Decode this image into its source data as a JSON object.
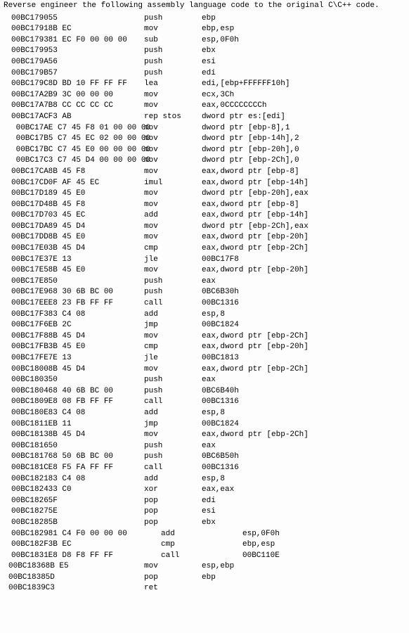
{
  "title": "Reverse engineer the following assembly language code to the original C\\C++ code.",
  "lines": [
    {
      "addr": "00BC1790",
      "bytes": "55",
      "mnem": "push",
      "ops": "ebp",
      "g": 1
    },
    {
      "addr": "00BC1791",
      "bytes": "8B EC",
      "mnem": "mov",
      "ops": "ebp,esp",
      "g": 1
    },
    {
      "addr": "00BC1793",
      "bytes": "81 EC F0 00 00 00",
      "mnem": "sub",
      "ops": "esp,0F0h",
      "g": 1
    },
    {
      "addr": "00BC1799",
      "bytes": "53",
      "mnem": "push",
      "ops": "ebx",
      "g": 1
    },
    {
      "addr": "00BC179A",
      "bytes": "56",
      "mnem": "push",
      "ops": "esi",
      "g": 1
    },
    {
      "addr": "00BC179B",
      "bytes": "57",
      "mnem": "push",
      "ops": "edi",
      "g": 1
    },
    {
      "addr": "00BC179C",
      "bytes": "8D BD 10 FF FF FF",
      "mnem": "lea",
      "ops": "edi,[ebp+FFFFFF10h]",
      "g": 1
    },
    {
      "addr": "00BC17A2",
      "bytes": "B9 3C 00 00 00",
      "mnem": "mov",
      "ops": "ecx,3Ch",
      "g": 1
    },
    {
      "addr": "00BC17A7",
      "bytes": "B8 CC CC CC CC",
      "mnem": "mov",
      "ops": "eax,0CCCCCCCCh",
      "g": 1
    },
    {
      "addr": "00BC17AC",
      "bytes": "F3 AB",
      "mnem": "rep stos",
      "ops": "dword ptr es:[edi]",
      "g": 1
    },
    {
      "addr": "00BC17AE",
      "bytes": "C7 45 F8 01 00 00 00",
      "mnem": "mov",
      "ops": "dword ptr [ebp-8],1",
      "g": 2
    },
    {
      "addr": "00BC17B5",
      "bytes": "C7 45 EC 02 00 00 00",
      "mnem": "mov",
      "ops": "dword ptr [ebp-14h],2",
      "g": 2
    },
    {
      "addr": "00BC17BC",
      "bytes": "C7 45 E0 00 00 00 00",
      "mnem": "mov",
      "ops": "dword ptr [ebp-20h],0",
      "g": 2
    },
    {
      "addr": "00BC17C3",
      "bytes": "C7 45 D4 00 00 00 00",
      "mnem": "mov",
      "ops": "dword ptr [ebp-2Ch],0",
      "g": 2
    },
    {
      "addr": "00BC17CA",
      "bytes": "8B 45 F8",
      "mnem": "mov",
      "ops": "eax,dword ptr [ebp-8]",
      "g": 1
    },
    {
      "addr": "00BC17CD",
      "bytes": "0F AF 45 EC",
      "mnem": "imul",
      "ops": "eax,dword ptr [ebp-14h]",
      "g": 1
    },
    {
      "addr": "00BC17D1",
      "bytes": "89 45 E0",
      "mnem": "mov",
      "ops": "dword ptr [ebp-20h],eax",
      "g": 1
    },
    {
      "addr": "00BC17D4",
      "bytes": "8B 45 F8",
      "mnem": "mov",
      "ops": "eax,dword ptr [ebp-8]",
      "g": 1
    },
    {
      "addr": "00BC17D7",
      "bytes": "03 45 EC",
      "mnem": "add",
      "ops": "eax,dword ptr [ebp-14h]",
      "g": 1
    },
    {
      "addr": "00BC17DA",
      "bytes": "89 45 D4",
      "mnem": "mov",
      "ops": "dword ptr [ebp-2Ch],eax",
      "g": 1
    },
    {
      "addr": "00BC17DD",
      "bytes": "8B 45 E0",
      "mnem": "mov",
      "ops": "eax,dword ptr [ebp-20h]",
      "g": 1
    },
    {
      "addr": "00BC17E0",
      "bytes": "3B 45 D4",
      "mnem": "cmp",
      "ops": "eax,dword ptr [ebp-2Ch]",
      "g": 1
    },
    {
      "addr": "00BC17E3",
      "bytes": "7E 13",
      "mnem": "jle",
      "ops": "00BC17F8",
      "g": 1
    },
    {
      "addr": "00BC17E5",
      "bytes": "8B 45 E0",
      "mnem": "mov",
      "ops": "eax,dword ptr [ebp-20h]",
      "g": 1
    },
    {
      "addr": "00BC17E8",
      "bytes": "50",
      "mnem": "push",
      "ops": "eax",
      "g": 1
    },
    {
      "addr": "00BC17E9",
      "bytes": "68 30 6B BC 00",
      "mnem": "push",
      "ops": "0BC6B30h",
      "g": 1
    },
    {
      "addr": "00BC17EE",
      "bytes": "E8 23 FB FF FF",
      "mnem": "call",
      "ops": "00BC1316",
      "g": 1
    },
    {
      "addr": "00BC17F3",
      "bytes": "83 C4 08",
      "mnem": "add",
      "ops": "esp,8",
      "g": 1
    },
    {
      "addr": "00BC17F6",
      "bytes": "EB 2C",
      "mnem": "jmp",
      "ops": "00BC1824",
      "g": 1
    },
    {
      "addr": "00BC17F8",
      "bytes": "8B 45 D4",
      "mnem": "mov",
      "ops": "eax,dword ptr [ebp-2Ch]",
      "g": 1
    },
    {
      "addr": "00BC17FB",
      "bytes": "3B 45 E0",
      "mnem": "cmp",
      "ops": "eax,dword ptr [ebp-20h]",
      "g": 1
    },
    {
      "addr": "00BC17FE",
      "bytes": "7E 13",
      "mnem": "jle",
      "ops": "00BC1813",
      "g": 1
    },
    {
      "addr": "00BC1800",
      "bytes": "8B 45 D4",
      "mnem": "mov",
      "ops": "eax,dword ptr [ebp-2Ch]",
      "g": 1
    },
    {
      "addr": "00BC1803",
      "bytes": "50",
      "mnem": "push",
      "ops": "eax",
      "g": 1
    },
    {
      "addr": "00BC1804",
      "bytes": "68 40 6B BC 00",
      "mnem": "push",
      "ops": "0BC6B40h",
      "g": 1
    },
    {
      "addr": "00BC1809",
      "bytes": "E8 08 FB FF FF",
      "mnem": "call",
      "ops": "00BC1316",
      "g": 1
    },
    {
      "addr": "00BC180E",
      "bytes": "83 C4 08",
      "mnem": "add",
      "ops": "esp,8",
      "g": 1
    },
    {
      "addr": "00BC1811",
      "bytes": "EB 11",
      "mnem": "jmp",
      "ops": "00BC1824",
      "g": 1
    },
    {
      "addr": "00BC1813",
      "bytes": "8B 45 D4",
      "mnem": "mov",
      "ops": "eax,dword ptr [ebp-2Ch]",
      "g": 1
    },
    {
      "addr": "00BC1816",
      "bytes": "50",
      "mnem": "push",
      "ops": "eax",
      "g": 1
    },
    {
      "addr": "00BC1817",
      "bytes": "68 50 6B BC 00",
      "mnem": "push",
      "ops": "0BC6B50h",
      "g": 1
    },
    {
      "addr": "00BC181C",
      "bytes": "E8 F5 FA FF FF",
      "mnem": "call",
      "ops": "00BC1316",
      "g": 1
    },
    {
      "addr": "00BC1821",
      "bytes": "83 C4 08",
      "mnem": "add",
      "ops": "esp,8",
      "g": 1
    },
    {
      "addr": "00BC1824",
      "bytes": "33 C0",
      "mnem": "xor",
      "ops": "eax,eax",
      "g": 1
    },
    {
      "addr": "00BC1826",
      "bytes": "5F",
      "mnem": "pop",
      "ops": "edi",
      "g": 1
    },
    {
      "addr": "00BC1827",
      "bytes": "5E",
      "mnem": "pop",
      "ops": "esi",
      "g": 1
    },
    {
      "addr": "00BC1828",
      "bytes": "5B",
      "mnem": "pop",
      "ops": "ebx",
      "g": 1
    },
    {
      "addr": "00BC1829",
      "bytes": "81 C4 F0 00 00 00",
      "mnem": "add",
      "ops": "esp,0F0h",
      "g": 3
    },
    {
      "addr": "00BC182F",
      "bytes": "3B EC",
      "mnem": "cmp",
      "ops": "ebp,esp",
      "g": 3
    },
    {
      "addr": "00BC1831",
      "bytes": "E8 D8 F8 FF FF",
      "mnem": "call",
      "ops": "00BC110E",
      "g": 3
    },
    {
      "addr": "00BC1836",
      "bytes": "8B E5",
      "mnem": "mov",
      "ops": "esp,ebp",
      "g": 4
    },
    {
      "addr": "00BC1838",
      "bytes": "5D",
      "mnem": "pop",
      "ops": "ebp",
      "g": 4
    },
    {
      "addr": "00BC1839",
      "bytes": "C3",
      "mnem": "ret",
      "ops": "",
      "g": 4
    }
  ]
}
